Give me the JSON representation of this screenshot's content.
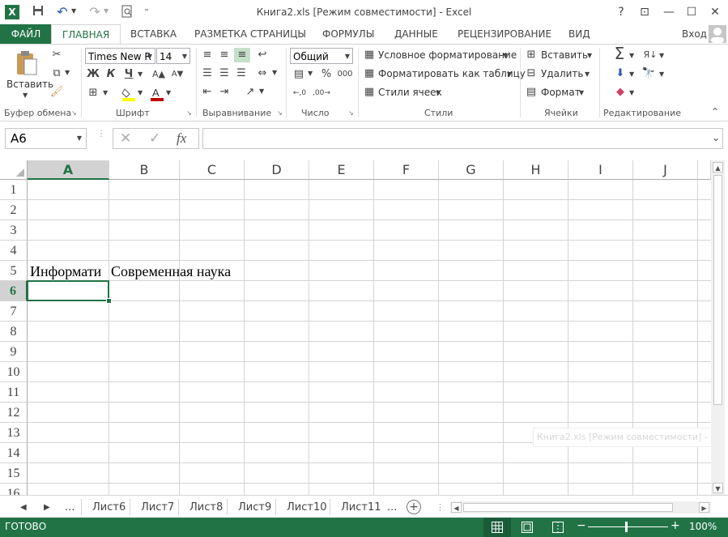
{
  "window": {
    "title": "Книга2.xls  [Режим совместимости] - Excel",
    "help": "?",
    "restore_ribbon": "⊡",
    "minimize": "—",
    "maximize": "☐",
    "close": "✕"
  },
  "qat": {
    "excel_icon": "X",
    "save": "💾",
    "undo": "↶",
    "redo": "↷",
    "preview": "🔍",
    "more": "⁼"
  },
  "tabs": {
    "file": "ФАЙЛ",
    "home": "ГЛАВНАЯ",
    "insert": "ВСТАВКА",
    "page_layout": "РАЗМЕТКА СТРАНИЦЫ",
    "formulas": "ФОРМУЛЫ",
    "data": "ДАННЫЕ",
    "review": "РЕЦЕНЗИРОВАНИЕ",
    "view": "ВИД",
    "signin": "Вход"
  },
  "ribbon": {
    "clipboard": {
      "label": "Буфер обмена",
      "paste": "Вставить"
    },
    "font": {
      "label": "Шрифт",
      "name": "Times New R",
      "size": "14",
      "bold": "Ж",
      "italic": "К",
      "underline": "Ч"
    },
    "alignment": {
      "label": "Выравнивание"
    },
    "number": {
      "label": "Число",
      "format": "Общий",
      "percent": "%",
      "thousands": "000"
    },
    "styles": {
      "label": "Стили",
      "conditional": "Условное форматирование",
      "as_table": "Форматировать как таблицу",
      "cell_styles": "Стили ячеек"
    },
    "cells": {
      "label": "Ячейки",
      "insert": "Вставить",
      "delete": "Удалить",
      "format": "Формат"
    },
    "editing": {
      "label": "Редактирование",
      "sum": "Σ"
    }
  },
  "formula_bar": {
    "name_box": "A6",
    "cancel": "✕",
    "enter": "✓",
    "fx": "fx",
    "value": ""
  },
  "columns": [
    "A",
    "B",
    "C",
    "D",
    "E",
    "F",
    "G",
    "H",
    "I",
    "J"
  ],
  "rows": [
    "1",
    "2",
    "3",
    "4",
    "5",
    "6",
    "7",
    "8",
    "9",
    "10",
    "11",
    "12",
    "13",
    "14",
    "15",
    "16"
  ],
  "cells": {
    "A5": "Информати",
    "B5": "Современная наука"
  },
  "tooltip": "Книга2.xls  [Режим совместимости] - Excel",
  "sheets": {
    "prev_ellipsis": "...",
    "tabs": [
      "Лист6",
      "Лист7",
      "Лист8",
      "Лист9",
      "Лист10",
      "Лист11"
    ],
    "next_ellipsis": "...",
    "add": "+"
  },
  "status": {
    "ready": "ГОТОВО",
    "zoom": "100%"
  },
  "colors": {
    "accent": "#217346",
    "grid": "#d4d4d4",
    "header_selected": "#d2d2d2"
  }
}
